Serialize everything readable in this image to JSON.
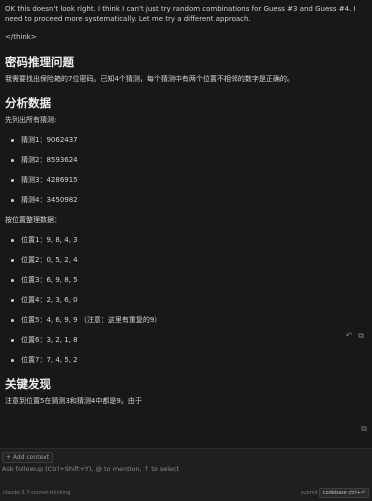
{
  "chat": {
    "intro_text": "OK this doesn't look right. I think I can't just try random combinations for Guess #3 and Guess #4. I need to proceed more systematically. Let me try a different approach.",
    "think_close": "</think>",
    "section1": {
      "title": "密码推理问题",
      "body": "我需要找出保险箱的7位密码。已知4个猜测，每个猜测中有两个位置不相邻的数字是正确的。"
    },
    "section2": {
      "title": "分析数据",
      "list_intro": "先列出所有猜测:",
      "guesses": [
        "猜测1：9062437",
        "猜测2：8593624",
        "猜测3：4286915",
        "猜测4：3450982"
      ],
      "positions_intro": "按位置整理数据：",
      "positions": [
        "位置1：9, 8, 4, 3",
        "位置2：0, 5, 2, 4",
        "位置3：6, 9, 8, 5",
        "位置4：2, 3, 6, 0",
        "位置5：4, 6, 9, 9  （注意：这里有重复的9）",
        "位置6：3, 2, 1, 8",
        "位置7：7, 4, 5, 2"
      ]
    },
    "section3": {
      "title": "关键发现",
      "body": "注意到位置5在猜测3和猜测4中都是9。由于"
    },
    "actions": {
      "undo_icon": "undo-icon",
      "copy_icon": "copy-icon",
      "undo_glyph": "↶",
      "copy_glyph": "⧉"
    }
  },
  "input": {
    "add_context_label": "+ Add context",
    "placeholder": "Ask followup (Ctrl+Shift+Y), @ to mention, ↑ to select",
    "model_name": "claude-3.7-sonnet-thinking",
    "submit_hint": "submit",
    "codebase_label": "codebase ctrl+⏎"
  }
}
